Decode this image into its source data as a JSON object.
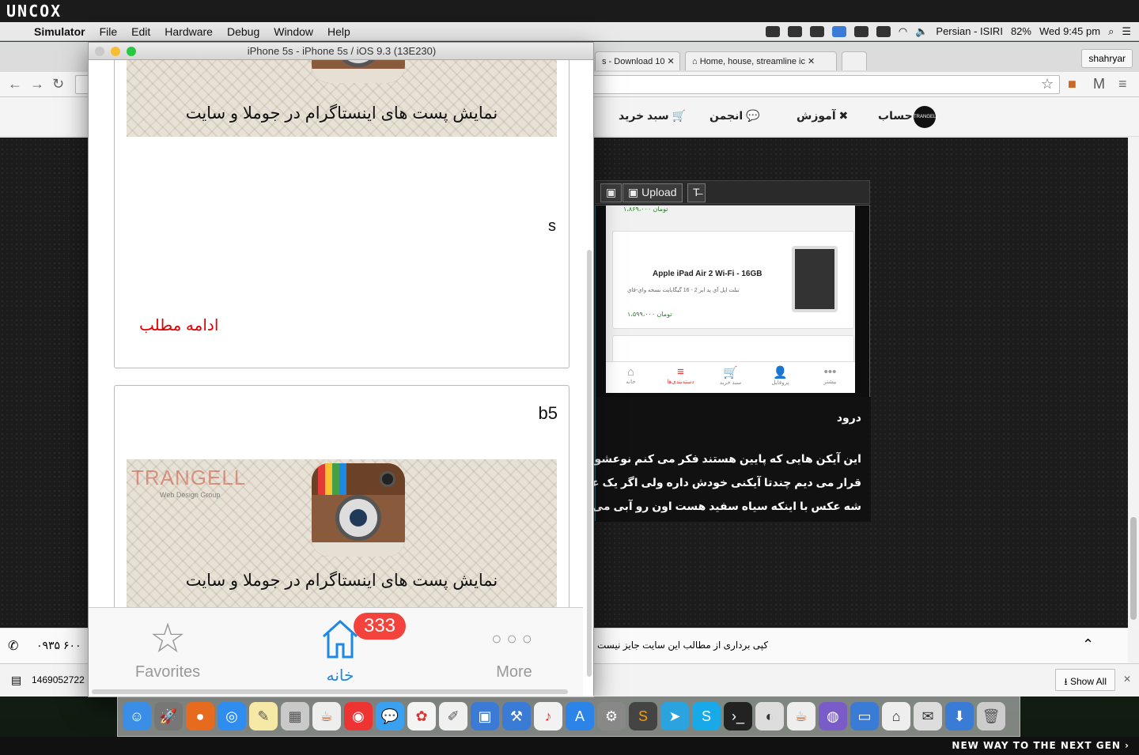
{
  "brand": {
    "top_logo": "UNCOX",
    "bottom_tagline": "NEW WAY TO THE NEXT GEN ›"
  },
  "menubar": {
    "app": "Simulator",
    "items": [
      "File",
      "Edit",
      "Hardware",
      "Debug",
      "Window",
      "Help"
    ],
    "input_source": "Persian - ISIRI",
    "battery": "82%",
    "clock": "Wed 9:45 pm"
  },
  "browser": {
    "tabs": [
      {
        "label": "s - Download 10"
      },
      {
        "label": "Home, house, streamline ic"
      }
    ],
    "profile": "shahryar",
    "site_nav": {
      "account": "حساب",
      "training": "آموزش",
      "forum": "انجمن",
      "cart": "سبد خرید",
      "logo": "TRANGELL"
    },
    "editor": {
      "upload_label": "Upload",
      "screenshot": {
        "price_top": "۱،۸۶۹،۰۰۰ تومان",
        "product_title": "Apple iPad Air 2 Wi-Fi - 16GB",
        "product_subtitle": "تبلت اپل آي پد اير 2 - 16 گيگابايت نسخه واي-فاي",
        "product_price": "۱،۵۹۹،۰۰۰ تومان",
        "tabs": [
          {
            "icon": "⌂",
            "label": "خانه",
            "active": false
          },
          {
            "icon": "≡",
            "label": "دسته‌بندی‌ها",
            "active": true
          },
          {
            "icon": "🛒",
            "label": "سبد خرید",
            "active": false
          },
          {
            "icon": "👤",
            "label": "پروفایل",
            "active": false
          },
          {
            "icon": "•••",
            "label": "بیشتر",
            "active": false
          }
        ]
      },
      "comment": {
        "greeting": "درود",
        "line1": "این آیکن هایی که پایین هستند فکر می کنم نوعشون",
        "line2": "قرار می دیم چندتا آیکنی خودش داره ولی اگر یک عکس",
        "line3": "شه عکس با اینکه سیاه سفید هست اون رو آبی می کنه و"
      }
    },
    "footer": {
      "phone": "۰۹۳۵ ۶۰۰",
      "copyright": "کپی برداری از مطالب این سایت جایز نیست"
    },
    "download": {
      "filename": "1469052722",
      "show_all": "Show All"
    }
  },
  "simulator": {
    "title": "iPhone 5s - iPhone 5s / iOS 9.3 (13E230)",
    "cards": [
      {
        "banner_text": "نمایش پست های اینستاگرام در جوملا و سایت",
        "body": "s",
        "read_more": "ادامه مطلب"
      },
      {
        "title": "b5",
        "brand_text": "TRANGELL",
        "brand_sub": "Web Design Group",
        "banner_text": "نمایش پست های اینستاگرام در جوملا و سایت"
      }
    ],
    "tabbar": {
      "favorites": "Favorites",
      "home": "خانه",
      "more": "More",
      "badge": "333"
    }
  },
  "colors": {
    "ios_blue": "#1e88e5",
    "badge_red": "#f4433c",
    "read_more_red": "#e00000"
  }
}
